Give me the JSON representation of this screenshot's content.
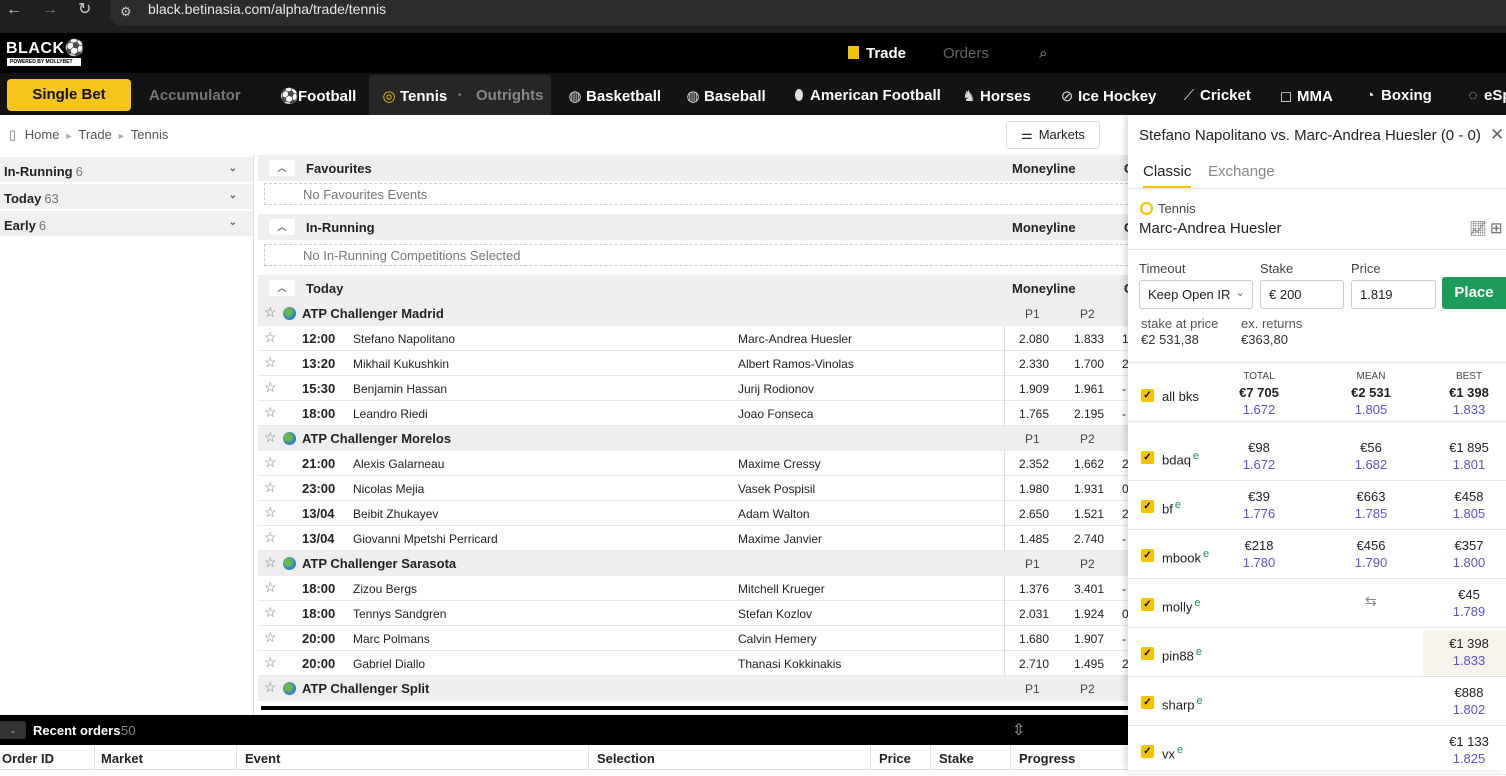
{
  "browser": {
    "url": "black.betinasia.com/alpha/trade/tennis"
  },
  "header": {
    "logo": "BLACK⚽",
    "logo_sub": "POWERED BY MOLLYBET",
    "trade_label": "Trade",
    "orders_label": "Orders"
  },
  "sportsbar": {
    "single_bet": "Single Bet",
    "accumulator": "Accumulator",
    "sports": [
      "Football",
      "Tennis",
      "Outrights",
      "Basketball",
      "Baseball",
      "American Football",
      "Horses",
      "Ice Hockey",
      "Cricket",
      "MMA",
      "Boxing",
      "eSpo"
    ]
  },
  "breadcrumb": [
    "Home",
    "Trade",
    "Tennis"
  ],
  "markets_button": "Markets",
  "left": [
    {
      "label": "In-Running",
      "count": "6"
    },
    {
      "label": "Today",
      "count": "63"
    },
    {
      "label": "Early",
      "count": "6"
    }
  ],
  "center": {
    "favourites": {
      "title": "Favourites",
      "col": "Moneyline",
      "empty": "No Favourites Events"
    },
    "inrunning": {
      "title": "In-Running",
      "col": "Moneyline",
      "empty": "No In-Running Competitions Selected"
    },
    "today": {
      "title": "Today",
      "col": "Moneyline"
    },
    "cut_letter": "C",
    "p1": "P1",
    "p2": "P2",
    "competitions": [
      {
        "name": "ATP Challenger Madrid",
        "matches": [
          {
            "time": "12:00",
            "home": "Stefano Napolitano",
            "away": "Marc-Andrea Huesler",
            "p1": "2.080",
            "p2": "1.833",
            "c": "1"
          },
          {
            "time": "13:20",
            "home": "Mikhail Kukushkin",
            "away": "Albert Ramos-Vinolas",
            "p1": "2.330",
            "p2": "1.700",
            "c": "2"
          },
          {
            "time": "15:30",
            "home": "Benjamin Hassan",
            "away": "Jurij Rodionov",
            "p1": "1.909",
            "p2": "1.961",
            "c": "-"
          },
          {
            "time": "18:00",
            "home": "Leandro Riedi",
            "away": "Joao Fonseca",
            "p1": "1.765",
            "p2": "2.195",
            "c": "-"
          }
        ]
      },
      {
        "name": "ATP Challenger Morelos",
        "matches": [
          {
            "time": "21:00",
            "home": "Alexis Galarneau",
            "away": "Maxime Cressy",
            "p1": "2.352",
            "p2": "1.662",
            "c": "2"
          },
          {
            "time": "23:00",
            "home": "Nicolas Mejia",
            "away": "Vasek Pospisil",
            "p1": "1.980",
            "p2": "1.931",
            "c": "0"
          },
          {
            "time": "13/04",
            "home": "Beibit Zhukayev",
            "away": "Adam Walton",
            "p1": "2.650",
            "p2": "1.521",
            "c": "2"
          },
          {
            "time": "13/04",
            "home": "Giovanni Mpetshi Perricard",
            "away": "Maxime Janvier",
            "p1": "1.485",
            "p2": "2.740",
            "c": "-"
          }
        ]
      },
      {
        "name": "ATP Challenger Sarasota",
        "matches": [
          {
            "time": "18:00",
            "home": "Zizou Bergs",
            "away": "Mitchell Krueger",
            "p1": "1.376",
            "p2": "3.401",
            "c": "-"
          },
          {
            "time": "18:00",
            "home": "Tennys Sandgren",
            "away": "Stefan Kozlov",
            "p1": "2.031",
            "p2": "1.924",
            "c": "0"
          },
          {
            "time": "20:00",
            "home": "Marc Polmans",
            "away": "Calvin Hemery",
            "p1": "1.680",
            "p2": "1.907",
            "c": "-"
          },
          {
            "time": "20:00",
            "home": "Gabriel Diallo",
            "away": "Thanasi Kokkinakis",
            "p1": "2.710",
            "p2": "1.495",
            "c": "2"
          }
        ]
      },
      {
        "name": "ATP Challenger Split",
        "matches": []
      }
    ]
  },
  "orders": {
    "title": "Recent orders",
    "count": "50",
    "columns": [
      "Order ID",
      "Market",
      "Event",
      "Selection",
      "Price",
      "Stake",
      "Progress"
    ]
  },
  "betslip": {
    "event": "Stefano Napolitano vs. Marc-Andrea Huesler (0 - 0)",
    "tabs": [
      "Classic",
      "Exchange"
    ],
    "sport": "Tennis",
    "selection": "Marc-Andrea Huesler",
    "timeout_label": "Timeout",
    "timeout_value": "Keep Open IR",
    "stake_label": "Stake",
    "stake_value": "€ 200",
    "price_label": "Price",
    "price_value": "1.819",
    "place": "Place",
    "stake_at_price_label": "stake at price",
    "stake_at_price": "€2 531,38",
    "ex_returns_label": "ex. returns",
    "ex_returns": "€363,80",
    "col_total": "TOTAL",
    "col_mean": "MEAN",
    "col_best": "BEST",
    "all": {
      "name": "all bks",
      "total": "€7 705",
      "total_p": "1.672",
      "mean": "€2 531",
      "mean_p": "1.805",
      "best": "€1 398",
      "best_p": "1.833"
    },
    "bookies": [
      {
        "name": "bdaq",
        "total": "€98",
        "total_p": "1.672",
        "mean": "€56",
        "mean_p": "1.682",
        "best": "€1 895",
        "best_p": "1.801"
      },
      {
        "name": "bf",
        "total": "€39",
        "total_p": "1.776",
        "mean": "€663",
        "mean_p": "1.785",
        "best": "€458",
        "best_p": "1.805"
      },
      {
        "name": "mbook",
        "total": "€218",
        "total_p": "1.780",
        "mean": "€456",
        "mean_p": "1.790",
        "best": "€357",
        "best_p": "1.800"
      },
      {
        "name": "molly",
        "total": "",
        "total_p": "",
        "mean": "",
        "mean_p": "",
        "best": "€45",
        "best_p": "1.789"
      },
      {
        "name": "pin88",
        "total": "",
        "total_p": "",
        "mean": "",
        "mean_p": "",
        "best": "€1 398",
        "best_p": "1.833"
      },
      {
        "name": "sharp",
        "total": "",
        "total_p": "",
        "mean": "",
        "mean_p": "",
        "best": "€888",
        "best_p": "1.802"
      },
      {
        "name": "vx",
        "total": "",
        "total_p": "",
        "mean": "",
        "mean_p": "",
        "best": "€1 133",
        "best_p": "1.825"
      }
    ],
    "exchange_mark": "e"
  }
}
